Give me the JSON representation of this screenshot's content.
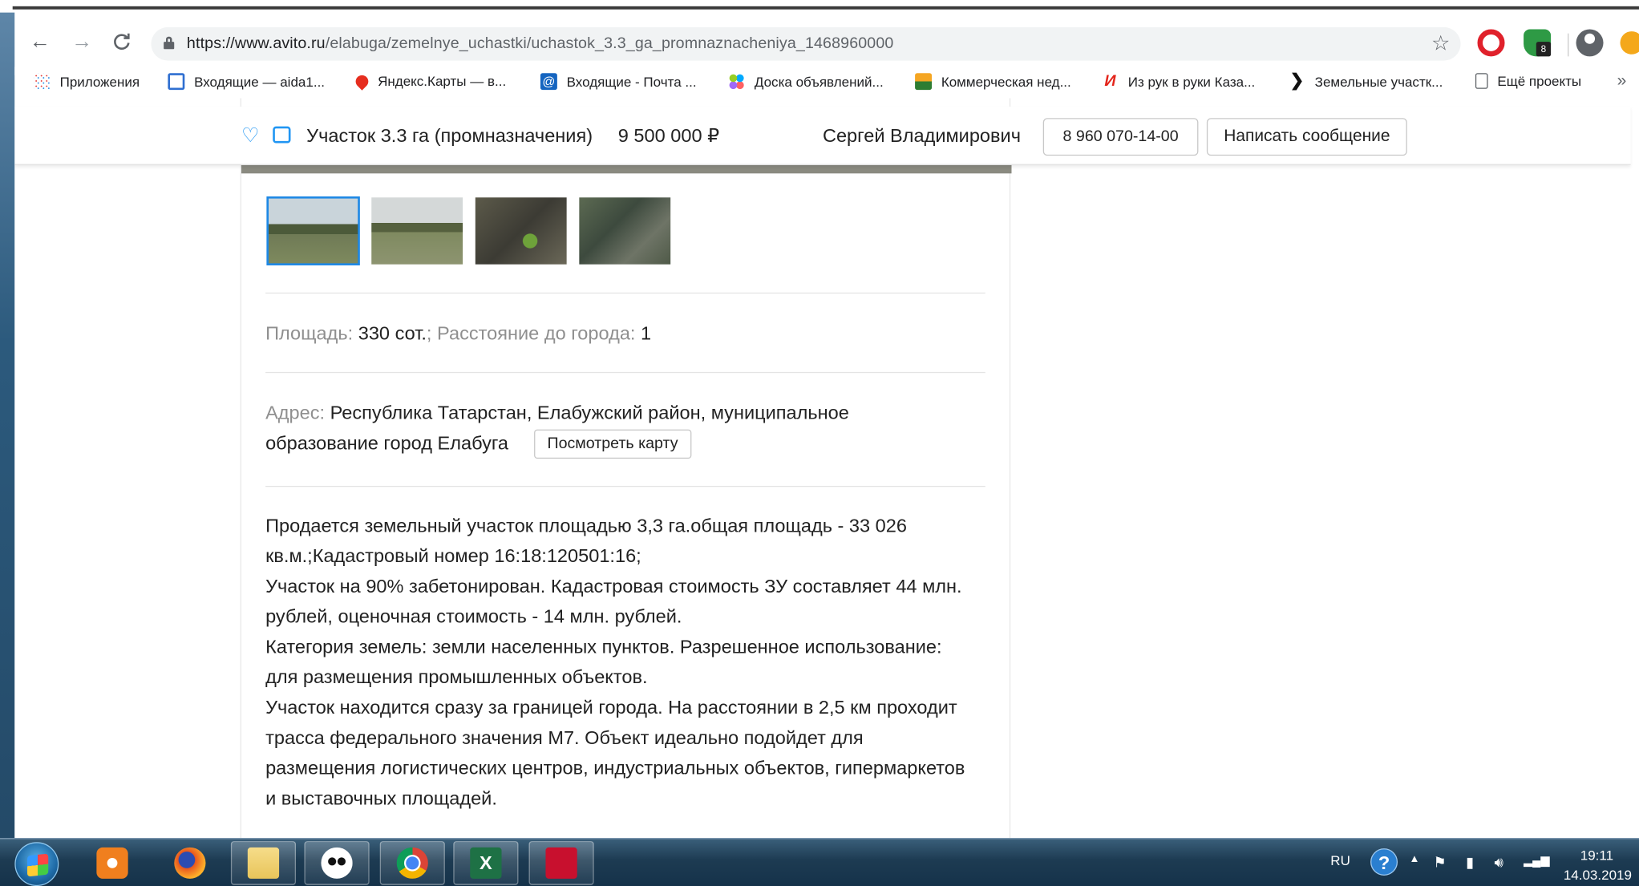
{
  "browser": {
    "url_host": "https://www.avito.ru",
    "url_path": "/elabuga/zemelnye_uchastki/uchastok_3.3_ga_promnaznacheniya_1468960000",
    "extension_badge": "8"
  },
  "bookmarks": [
    {
      "label": "Приложения",
      "icon": "apps-grid-icon",
      "color": "#1a73e8"
    },
    {
      "label": "Входящие — aida1...",
      "icon": "mail-icon",
      "color": "#2f6fd1"
    },
    {
      "label": "Яндекс.Карты — в...",
      "icon": "map-pin-icon",
      "color": "#e62e1f"
    },
    {
      "label": "Входящие - Почта ...",
      "icon": "at-sign-icon",
      "color": "#1565c0"
    },
    {
      "label": "Доска объявлений...",
      "icon": "avito-dots-icon",
      "color": "#97cf26"
    },
    {
      "label": "Коммерческая нед...",
      "icon": "building-icon",
      "color": "#f5a623"
    },
    {
      "label": "Из рук в руки Каза...",
      "icon": "irr-logo-icon",
      "color": "#e3251b"
    },
    {
      "label": "Земельные участк...",
      "icon": "arrow-logo-icon",
      "color": "#111111"
    },
    {
      "label": "Ещё проекты",
      "icon": "page-icon",
      "color": "#5f6368"
    }
  ],
  "bookmarks_more": "»",
  "sticky": {
    "title": "Участок 3.3 га (промназначения)",
    "price": "9 500 000  ₽",
    "seller": "Сергей Владимирович",
    "phone": "8 960 070-14-00",
    "message_button": "Написать сообщение"
  },
  "listing": {
    "area_label": "Площадь:",
    "area_value": "330 сот.",
    "sep": ";",
    "distance_label": "Расстояние до города:",
    "distance_value": "1",
    "address_label": "Адрес:",
    "address_line1": "Республика Татарстан, Елабужский район, муниципальное",
    "address_line2": "образование город Елабуга",
    "map_button": "Посмотреть карту",
    "description": [
      "Продается земельный участок площадью 3,3 га.общая площадь - 33 026",
      "кв.м.;Кадастровый номер 16:18:120501:16;",
      "Участок на 90% забетонирован. Кадастровая стоимость ЗУ составляет 44 млн.",
      "рублей, оценочная стоимость - 14 млн. рублей.",
      "Категория земель: земли населенных пунктов. Разрешенное использование:",
      "для размещения промышленных объектов.",
      "Участок находится сразу за границей города. На расстоянии в 2,5 км проходит",
      "трасса федерального значения М7. Объект идеально подойдет для",
      "размещения логистических центров, индустриальных объектов, гипермаркетов",
      "и выставочных площадей."
    ]
  },
  "taskbar": {
    "apps": [
      {
        "name": "media-player",
        "color": "#f07f1e"
      },
      {
        "name": "firefox",
        "color": "#e8571f"
      },
      {
        "name": "file-explorer",
        "color": "#e8c45a"
      },
      {
        "name": "panda-app",
        "color": "#ffffff"
      },
      {
        "name": "chrome",
        "color": "#db4437"
      },
      {
        "name": "excel",
        "color": "#1e7145"
      },
      {
        "name": "acrobat",
        "color": "#c8102e"
      }
    ],
    "lang": "RU",
    "help": "?",
    "time": "19:11",
    "date": "14.03.2019"
  },
  "colors": {
    "accent_blue": "#2196f3",
    "text": "#222222",
    "muted": "#8f8f8f"
  }
}
